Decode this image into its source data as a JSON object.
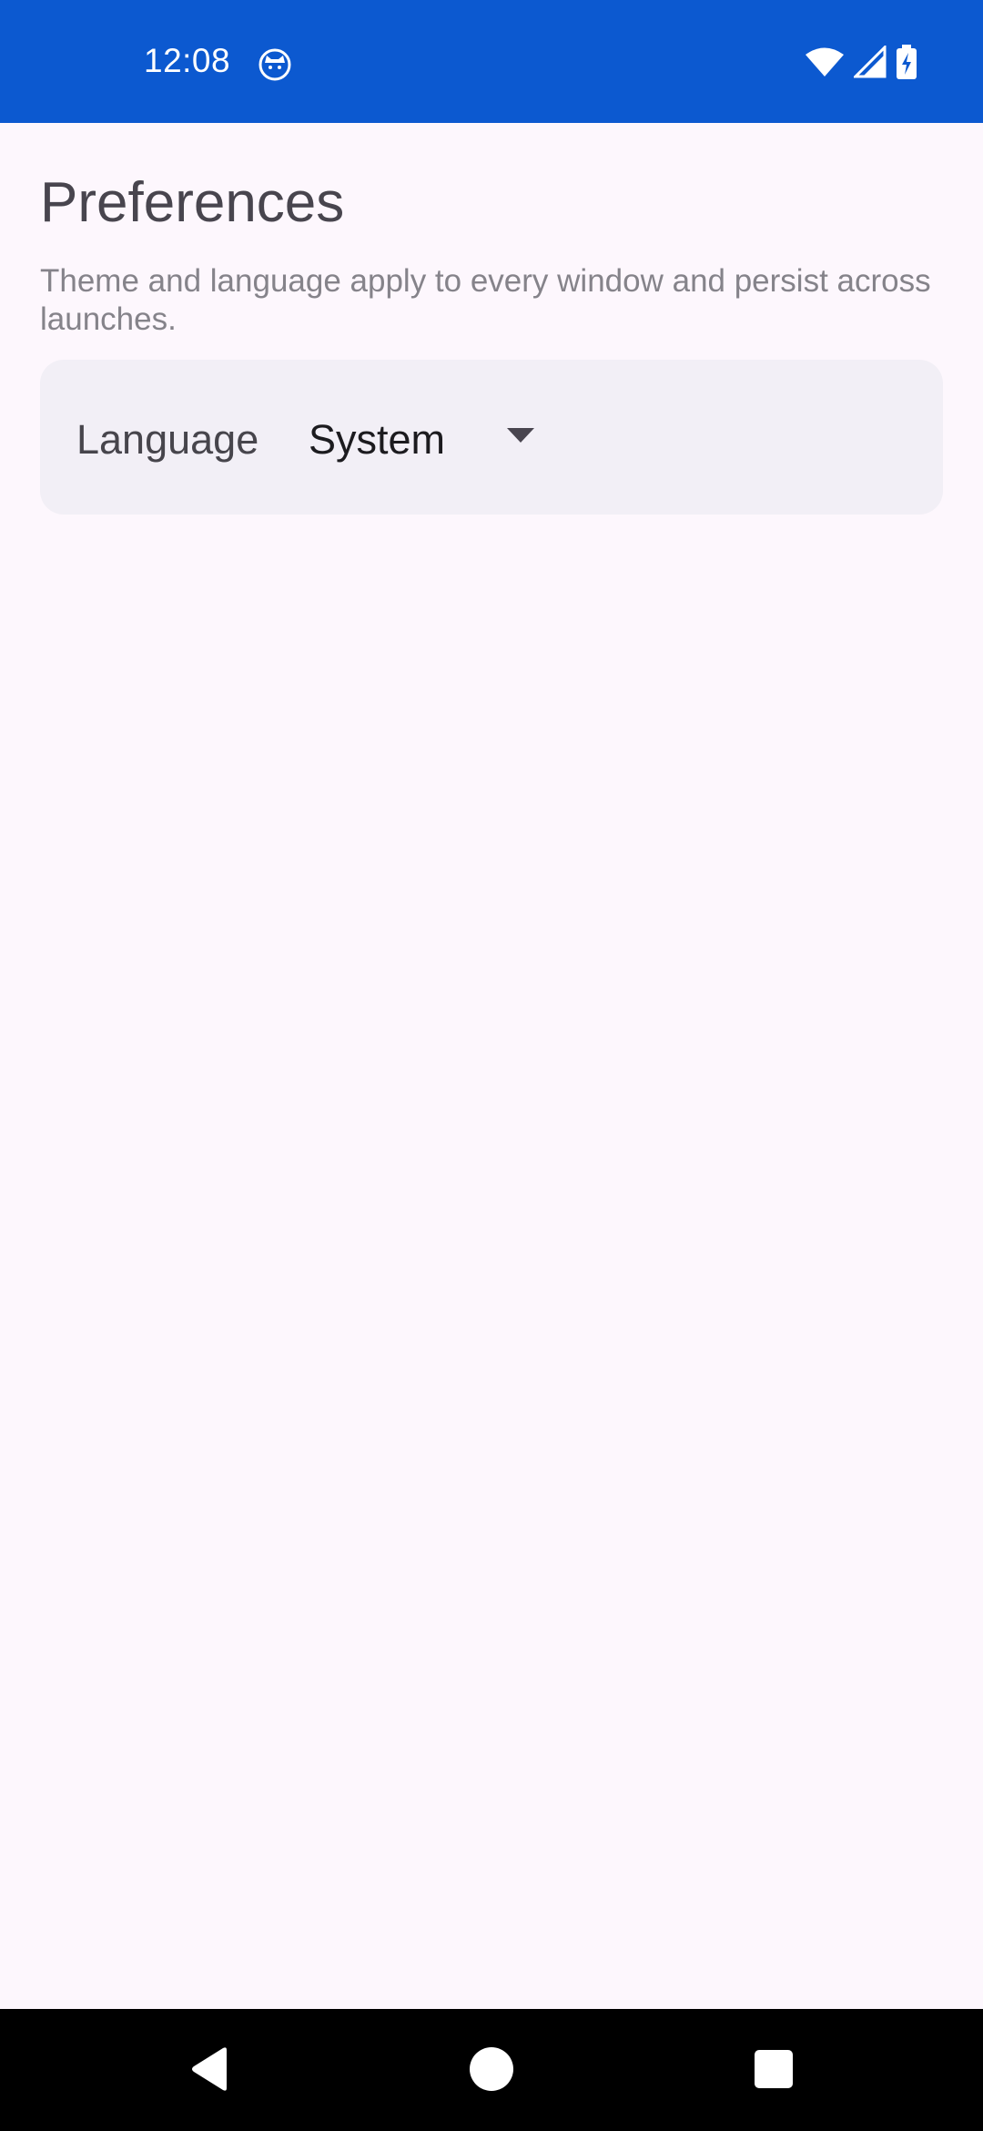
{
  "status_bar": {
    "time": "12:08",
    "app_icon": "cat-face-icon",
    "indicators": [
      "wifi-icon",
      "cellular-signal-icon",
      "battery-charging-icon"
    ],
    "background_color": "#0c59d0"
  },
  "page": {
    "title": "Preferences",
    "subtitle": "Theme and language apply to every window and persist across launches."
  },
  "language_setting": {
    "label": "Language",
    "selected_value": "System",
    "dropdown_icon": "dropdown-arrow-icon"
  },
  "navigation_bar": {
    "back": "back-triangle-icon",
    "home": "home-circle-icon",
    "recents": "recents-square-icon"
  },
  "colors": {
    "background": "#fdf7fd",
    "card_background": "#f2eff6",
    "title_text": "#48454e",
    "subtitle_text": "#85838a"
  }
}
